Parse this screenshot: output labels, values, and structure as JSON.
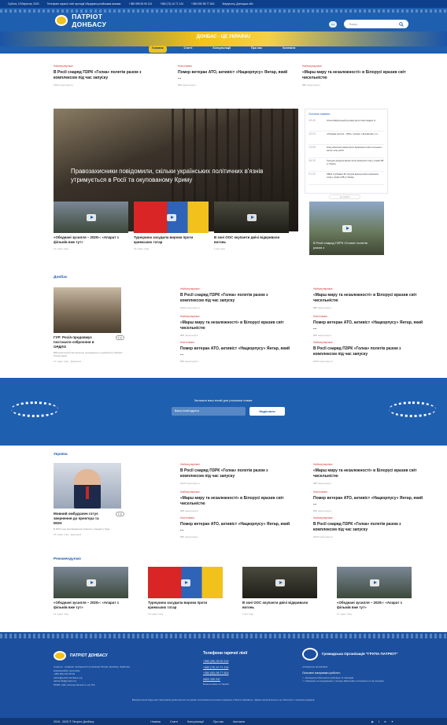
{
  "topbar": {
    "date": "Субота, 19 Вересня, 2020",
    "hotline_label": "Телефони гарячої лінії протидії гібридним російським атакам:",
    "phone1": "+380 995 36 90 124",
    "phone2": "+380 (73) 10 71 124",
    "phone3": "+380 050 98 77 824",
    "location": "Маріуполь, Донецька обл."
  },
  "header": {
    "logo_text": "ПАТРІОТ ДОНБАСУ",
    "slogan": "ДОНБАС - ЦЕ УКРАЇНА!",
    "lang": "UA",
    "search_placeholder": "Пошук..."
  },
  "nav": [
    "Головна",
    "Статті",
    "Консультації",
    "Про нас",
    "Контакти"
  ],
  "top_news": [
    {
      "category": "Найпопулярніше",
      "title": "В Росії снаряд ПЗРК «Голка» полетів разом з комплексом під час запуску",
      "meta": "2020 переглянуто"
    },
    {
      "category": "Нові новини",
      "title": "Помер ветеран АТО, активіст «Нацкорпусу» Янтар, який ...",
      "meta": "889 переглянуто"
    },
    {
      "category": "Найпопулярніше",
      "title": "«Марш миру та незалежності» в Білорусі вразив світ чисельністю",
      "meta": "888 переглянуто"
    }
  ],
  "hero": {
    "title": "Правозахисники повідомили, скільки українських політичних в'язнів утримується в Росії та окупованому Криму"
  },
  "latest": {
    "heading": "Останні новини",
    "items": [
      {
        "time": "19:42",
        "text": "Опісля Маріупольній рухливих дитячі свято відкриття"
      },
      {
        "time": "12:24",
        "text": "«Обєднані зусилля – 2020»: «Апарат з фільмів вже тут»"
      },
      {
        "time": "13:00",
        "text": "Кому небезпечні санкції проти Лукашенка та його оточення з метою тиску на ЄС"
      },
      {
        "time": "16:10",
        "text": "Турецька засудила вироки проти кримських татар у справі ХІВ ут-Тахрір»"
      },
      {
        "time": "21:31",
        "text": "ОБСЕ стурбоване ЄС загрузів виконує вороги кримських татар у справі «ХІВ ут-Тахрір»"
      }
    ],
    "more": "ще новини"
  },
  "videos": [
    {
      "title": "«Обєднані зусилля – 2020»: «Апарат з фільмів вже тут»",
      "meta": "11 годин тому"
    },
    {
      "title": "Турецчина засудила вироки проти кримських татар",
      "meta": "14 годин тому"
    },
    {
      "title": "В зоні ООС окупанти двічі відкривали вогонь",
      "meta": "1 дні тому"
    }
  ],
  "side_video": {
    "title": "В Росії снаряд ПЗРК «Голка» полетів разом з"
  },
  "donbas": {
    "heading": "Донбас",
    "feature_title": "ГУР: Росія продовжує постачати озброєння в ОРДЛО",
    "feature_badge": "5 хв",
    "feature_excerpt": "Військові аналітики визнали продовжують переброску бойових боєприпасів",
    "feature_meta": "11 годин тому",
    "feature_author": "Донецька",
    "col1": [
      {
        "category": "Найпопулярніше",
        "title": "В Росії снаряд ПЗРК «Голка» полетів разом з комплексом під час запуску",
        "meta": "2020 переглянуто"
      },
      {
        "category": "Найпопулярніше",
        "title": "«Марш миру та незалежності» в Білорусі вразив світ чисельністю",
        "meta": "888 переглянуто"
      },
      {
        "category": "Нові новини",
        "title": "Помер ветеран АТО, активіст «Нацкорпусу» Янтар, який ...",
        "meta": "889 переглянуто"
      }
    ],
    "col2": [
      {
        "category": "Найпопулярніше",
        "title": "«Марш миру та незалежності» в Білорусі вразив світ чисельністю",
        "meta": "888 переглянуто"
      },
      {
        "category": "Нові новини",
        "title": "Помер ветеран АТО, активіст «Нацкорпусу» Янтар, який ...",
        "meta": "889 переглянуто"
      },
      {
        "category": "Найпопулярніше",
        "title": "В Росії снаряд ПЗРК «Голка» полетів разом з комплексом під час запуску",
        "meta": "2020 переглянуто"
      }
    ]
  },
  "subscribe": {
    "title": "Залиште ваш email для розсилки новин:",
    "placeholder": "Ваша email адреса",
    "button": "Надіслати"
  },
  "ukraine": {
    "heading": "Україна",
    "feature_title": "Мовний омбудсмен готує звернення до прем'єра та МОН",
    "feature_badge": "5 хв",
    "feature_excerpt": "В 2021 році впровадження мовного стандарту буде...",
    "feature_meta": "16 годин тому",
    "feature_author": "Донецька",
    "col1": [
      {
        "category": "Найпопулярніше",
        "title": "В Росії снаряд ПЗРК «Голка» полетів разом з комплексом під час запуску",
        "meta": "2020 переглянуто"
      },
      {
        "category": "Найпопулярніше",
        "title": "«Марш миру та незалежності» в Білорусі вразив світ чисельністю",
        "meta": "888 переглянуто"
      },
      {
        "category": "Нові новини",
        "title": "Помер ветеран АТО, активіст «Нацкорпусу» Янтар, який ...",
        "meta": "889 переглянуто"
      }
    ],
    "col2": [
      {
        "category": "Найпопулярніше",
        "title": "«Марш миру та незалежності» в Білорусі вразив світ чисельністю",
        "meta": "888 переглянуто"
      },
      {
        "category": "Нові новини",
        "title": "Помер ветеран АТО, активіст «Нацкорпусу» Янтар, який ...",
        "meta": "889 переглянуто"
      },
      {
        "category": "Найпопулярніше",
        "title": "В Росії снаряд ПЗРК «Голка» полетів разом з комплексом під час запуску",
        "meta": "2020 переглянуто"
      }
    ]
  },
  "recommended": {
    "heading": "Рекомендуємо",
    "items": [
      {
        "title": "«Обєднані зусилля – 2020»: «Апарат з фільмів вже тут»",
        "meta": "11 годин тому"
      },
      {
        "title": "Турецчина засудила вироки проти кримських татар",
        "meta": "14 годин тому"
      },
      {
        "title": "В зоні ООС окупанти двічі відкривали вогонь",
        "meta": "1 дні тому"
      },
      {
        "title": "«Обєднані зусилля – 2020»: «Апарат з фільмів вже тут»",
        "meta": "11 годин тому"
      }
    ]
  },
  "footer": {
    "logo_text": "ПАТРІОТ ДОНБАСУ",
    "about": "Інтернет - видання громадської організації Патріот Донбасу. Здійснює інформаційну підтримку.",
    "phone": "+380 (99) 224 35 22",
    "email1": "editor@patriot-donbass.org",
    "email2": "patriot.d1@gmail.com",
    "address": "87500, Київ, Златоустівська 3, оф 704",
    "hotline_title": "Телефони гарячої лінії",
    "hotline": [
      "+380 (99) 36 90 124",
      "+380 (73) 10 71 124",
      "+380 (50) 98 77 824",
      "0800 339 247"
    ],
    "hotline_note": "Безкоштовно по Україні",
    "org_title": "Громадська Організація \"ГРУПА ПАТРІОТ\"",
    "org_sub": "громадська організація",
    "work_title": "Основні напрямки роботи:",
    "work": [
      "захищення військовослужбовців та інвалідів",
      "співпраця та координація у пошуку військових полонених та на пошуках"
    ],
    "disclaimer": "Використання будь-яких матеріалів дозволяється за умови посилання на інтернет-видання «Патріот Донбасу». Думки авторів можуть не збігатися з позицією редакції.",
    "copyright": "2016 - 2020 © Патріот Донбасу",
    "links": [
      "Новини",
      "Статті",
      "Консультації",
      "Про нас",
      "Контакти"
    ]
  }
}
